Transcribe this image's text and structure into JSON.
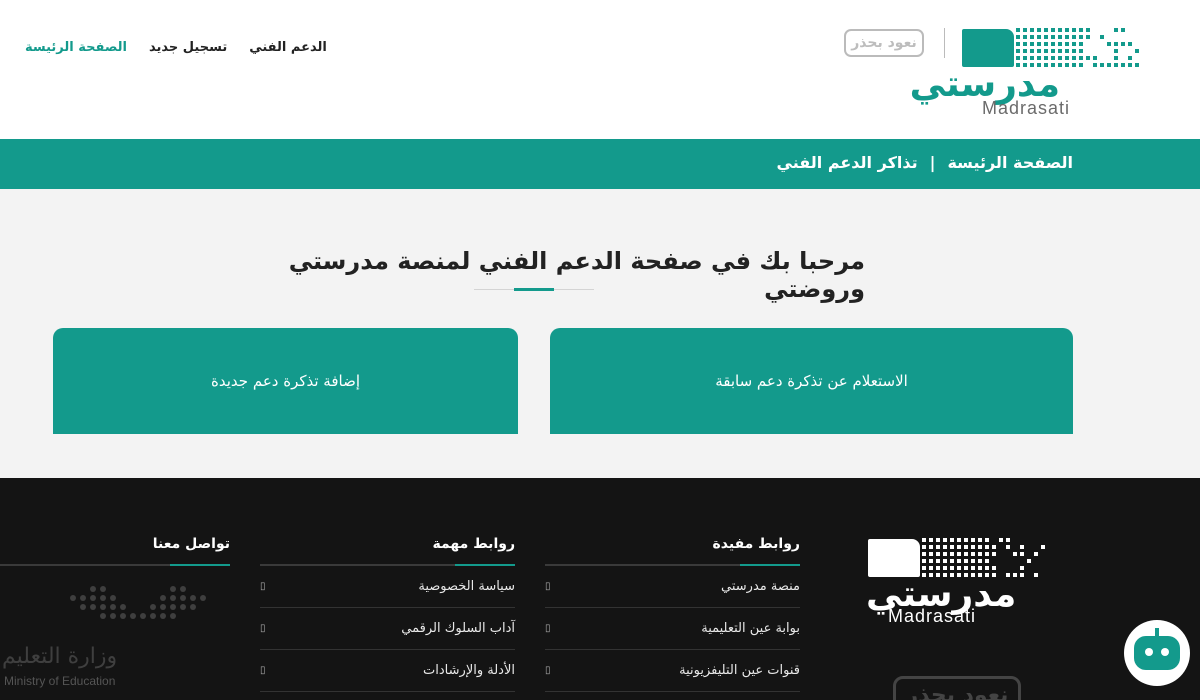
{
  "header": {
    "nav": [
      {
        "label": "الصفحة الرئيسة",
        "active": true
      },
      {
        "label": "تسجيل جديد",
        "active": false
      },
      {
        "label": "الدعم الفني",
        "active": false
      }
    ],
    "logo_ar": "مدرستي",
    "logo_en": "Madrasati",
    "badge": "نعود بحذر"
  },
  "breadcrumb": {
    "home": "الصفحة الرئيسة",
    "separator": "|",
    "current": "تذاكر الدعم الفني"
  },
  "main": {
    "welcome": "مرحبا بك في صفحة الدعم الفني لمنصة مدرستي وروضتي",
    "card_inquiry": "الاستعلام عن تذكرة دعم سابقة",
    "card_add": "إضافة تذكرة دعم جديدة"
  },
  "footer": {
    "logo_ar": "مدرستي",
    "logo_en": "Madrasati",
    "badge": "نعود بحذر",
    "useful_links": {
      "title": "روابط مفيدة",
      "items": [
        "منصة مدرستي",
        "بوابة عين التعليمية",
        "قنوات عين التليفزيونية"
      ]
    },
    "important_links": {
      "title": "روابط مهمة",
      "items": [
        "سياسة الخصوصية",
        "آداب السلوك الرقمي",
        "الأدلة والإرشادات"
      ]
    },
    "contact": {
      "title": "تواصل معنا",
      "moe_ar": "وزارة التعليم",
      "moe_en": "Ministry of Education"
    }
  },
  "colors": {
    "brand": "#139a8c",
    "footer_bg": "#141414",
    "main_bg": "#f3f3f3"
  },
  "icons": {
    "link_bullet": "square-icon",
    "chatbot": "robot-icon"
  }
}
